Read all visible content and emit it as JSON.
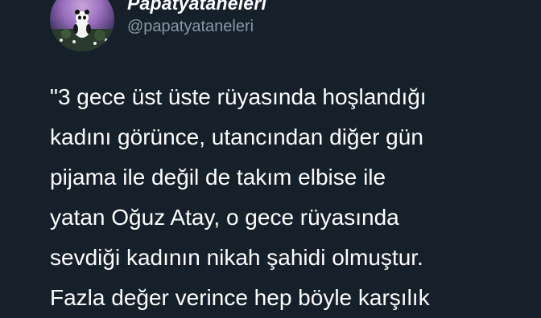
{
  "author": {
    "display_name": "Papatyataneleri",
    "handle": "@papatyataneleri",
    "avatar_icon": "profile-photo-panda-flowers"
  },
  "tweet": {
    "lines": [
      "\"3 gece üst üste rüyasında hoşlandığı",
      "kadını görünce, utancından diğer gün",
      "pijama ile değil de takım elbise ile",
      "yatan Oğuz Atay, o gece rüyasında",
      "sevdiği kadının nikah şahidi olmuştur.",
      "Fazla değer verince hep böyle karşılık"
    ]
  },
  "colors": {
    "background": "#15202b",
    "text": "#ffffff",
    "secondary_text": "#8899a6"
  }
}
